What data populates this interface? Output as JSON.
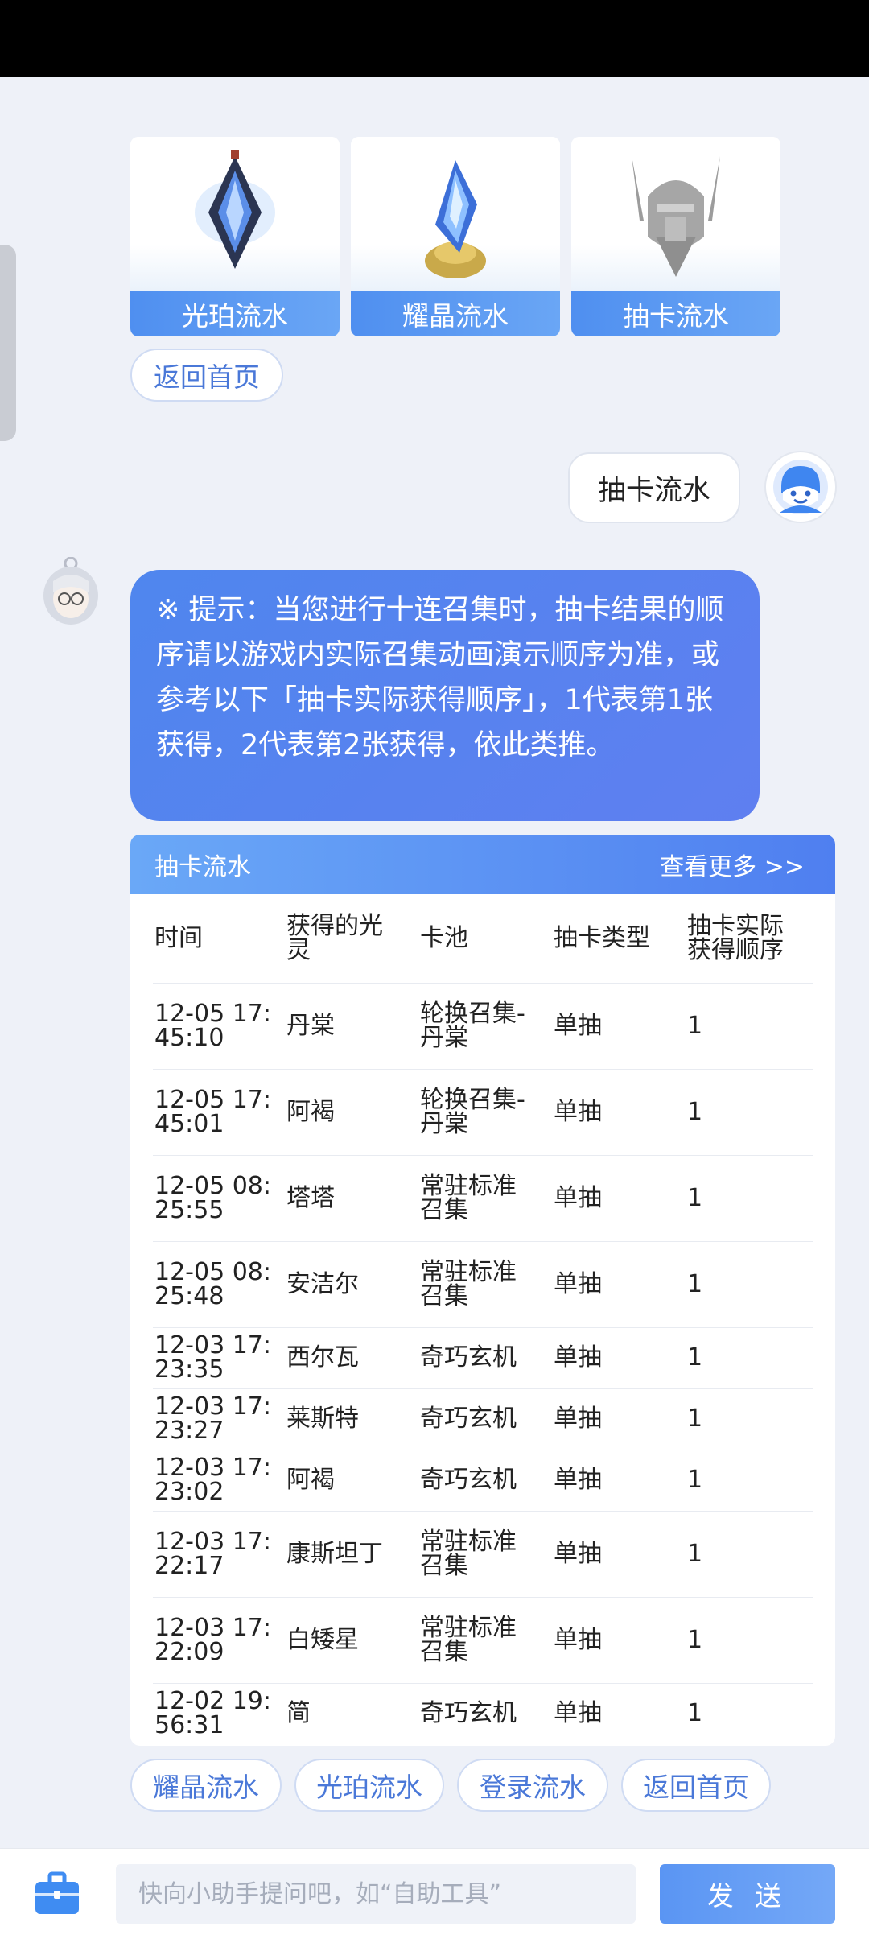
{
  "cards": [
    {
      "label": "光珀流水",
      "icon": "crystal-pendant-icon"
    },
    {
      "label": "耀晶流水",
      "icon": "blue-crystal-gold-icon"
    },
    {
      "label": "抽卡流水",
      "icon": "knight-emblem-icon"
    }
  ],
  "back_home_top": "返回首页",
  "user_message": "抽卡流水",
  "bot_tip": "※ 提示：当您进行十连召集时，抽卡结果的顺序请以游戏内实际召集动画演示顺序为准，或参考以下「抽卡实际获得顺序」，1代表第1张获得，2代表第2张获得，依此类推。",
  "table": {
    "title": "抽卡流水",
    "more": "查看更多 >>",
    "headers": [
      "时间",
      "获得的光灵",
      "卡池",
      "抽卡类型",
      "抽卡实际获得顺序"
    ],
    "rows": [
      [
        "12-05 17:45:10",
        "丹棠",
        "轮换召集-丹棠",
        "单抽",
        "1"
      ],
      [
        "12-05 17:45:01",
        "阿褐",
        "轮换召集-丹棠",
        "单抽",
        "1"
      ],
      [
        "12-05 08:25:55",
        "塔塔",
        "常驻标准召集",
        "单抽",
        "1"
      ],
      [
        "12-05 08:25:48",
        "安洁尔",
        "常驻标准召集",
        "单抽",
        "1"
      ],
      [
        "12-03 17:23:35",
        "西尔瓦",
        "奇巧玄机",
        "单抽",
        "1"
      ],
      [
        "12-03 17:23:27",
        "莱斯特",
        "奇巧玄机",
        "单抽",
        "1"
      ],
      [
        "12-03 17:23:02",
        "阿褐",
        "奇巧玄机",
        "单抽",
        "1"
      ],
      [
        "12-03 17:22:17",
        "康斯坦丁",
        "常驻标准召集",
        "单抽",
        "1"
      ],
      [
        "12-03 17:22:09",
        "白矮星",
        "常驻标准召集",
        "单抽",
        "1"
      ],
      [
        "12-02 19:56:31",
        "简",
        "奇巧玄机",
        "单抽",
        "1"
      ]
    ]
  },
  "quick_actions": [
    "耀晶流水",
    "光珀流水",
    "登录流水",
    "返回首页"
  ],
  "input": {
    "placeholder": "快向小助手提问吧，如“自助工具”",
    "value": ""
  },
  "send_label": "发 送",
  "colors": {
    "accent": "#4f86ee",
    "background": "#eef1f8"
  }
}
